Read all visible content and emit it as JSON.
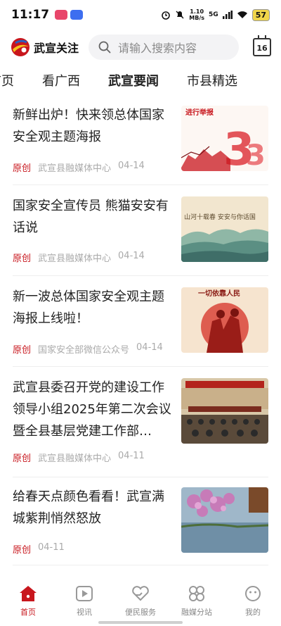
{
  "status_bar": {
    "time": "11:17",
    "net_speed_value": "1.10",
    "net_speed_unit": "MB/s",
    "signal": "5G",
    "battery": "57"
  },
  "header": {
    "logo_text": "武宣关注",
    "search_placeholder": "请输入搜索内容",
    "calendar_day": "16"
  },
  "tabs": [
    {
      "label": "首页"
    },
    {
      "label": "看广西"
    },
    {
      "label": "武宣要闻",
      "active": true
    },
    {
      "label": "市县精选"
    }
  ],
  "news": [
    {
      "title": "新鲜出炉！快来领总体国家安全观主题海报",
      "tag": "原创",
      "source": "武宣县融媒体中心",
      "date": "04-14",
      "thumb_text": "进行举报"
    },
    {
      "title": "国家安全宣传员 熊猫安安有话说",
      "tag": "原创",
      "source": "武宣县融媒体中心",
      "date": "04-14",
      "thumb_text": "山河十载春 安安与你话国"
    },
    {
      "title": "新一波总体国家安全观主题海报上线啦！",
      "tag": "原创",
      "source": "国家安全部微信公众号",
      "date": "04-14",
      "thumb_text": "一切依靠人民"
    },
    {
      "title": "武宣县委召开党的建设工作领导小组2025年第二次会议暨全县基层党建工作部…",
      "tag": "原创",
      "source": "武宣县融媒体中心",
      "date": "04-11"
    },
    {
      "title": "给春天点颜色看看！武宣满城紫荆悄然怒放",
      "tag": "原创",
      "source": "",
      "date": "04-11"
    }
  ],
  "bottom_nav": [
    {
      "label": "首页",
      "icon": "home-icon",
      "active": true
    },
    {
      "label": "视讯",
      "icon": "video-icon"
    },
    {
      "label": "便民服务",
      "icon": "heart-hand-icon"
    },
    {
      "label": "融媒分站",
      "icon": "grid-icon"
    },
    {
      "label": "我的",
      "icon": "smile-icon"
    }
  ],
  "colors": {
    "accent": "#c8161d",
    "meta_gray": "#aaaaaa",
    "search_bg": "#f3f3f5"
  }
}
